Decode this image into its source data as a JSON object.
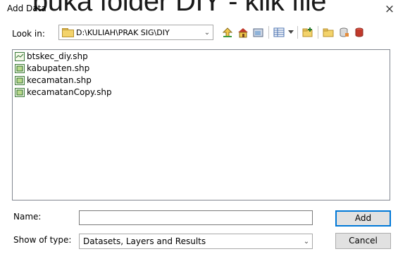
{
  "overlay_text": "buka folder DIY - klik file",
  "dialog": {
    "title": "Add Data",
    "close_symbol": "×"
  },
  "look_in": {
    "label": "Look in:",
    "value": "D:\\KULIAH\\PRAK SIG\\DIY"
  },
  "toolbar": {
    "icons": [
      "up-one-level-icon",
      "home-icon",
      "catalog-view-icon",
      "list-view-icon",
      "view-dropdown-icon",
      "new-folder-icon",
      "connect-folder-icon",
      "database-icon",
      "geodatabase-icon"
    ]
  },
  "files": [
    {
      "name": "btskec_diy.shp",
      "icon": "line-shapefile-icon"
    },
    {
      "name": "kabupaten.shp",
      "icon": "polygon-shapefile-icon"
    },
    {
      "name": "kecamatan.shp",
      "icon": "polygon-shapefile-icon"
    },
    {
      "name": "kecamatanCopy.shp",
      "icon": "polygon-shapefile-icon"
    }
  ],
  "name_field": {
    "label": "Name:",
    "value": ""
  },
  "show_type": {
    "label": "Show of type:",
    "value": "Datasets, Layers and Results"
  },
  "buttons": {
    "add": "Add",
    "cancel": "Cancel"
  }
}
